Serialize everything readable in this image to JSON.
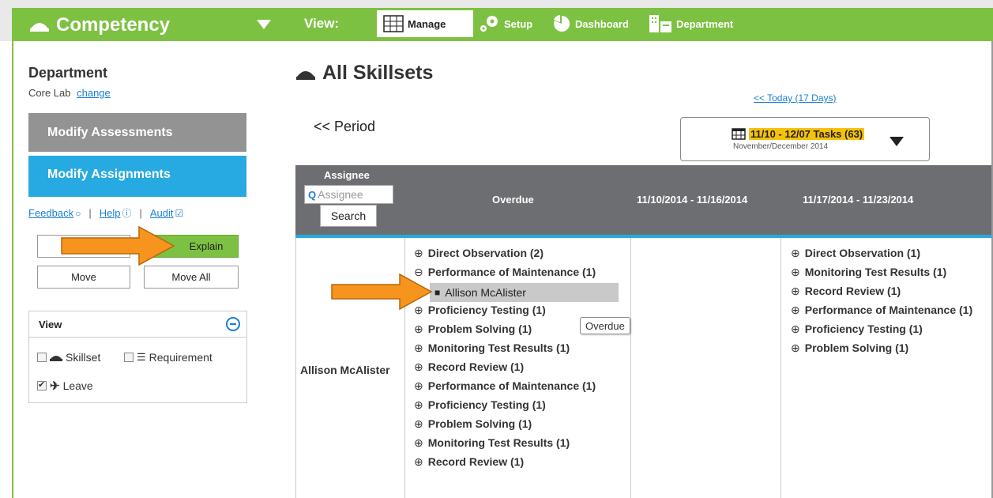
{
  "header": {
    "app_title": "Competency",
    "view_label": "View:",
    "nav": [
      {
        "label": "Manage",
        "icon": "grid-icon",
        "active": true
      },
      {
        "label": "Setup",
        "icon": "gears-icon"
      },
      {
        "label": "Dashboard",
        "icon": "pie-chart-icon"
      },
      {
        "label": "Department",
        "icon": "building-icon"
      }
    ],
    "accent_color": "#7dc142"
  },
  "sidebar": {
    "department_title": "Department",
    "department_name": "Core Lab",
    "change_link": "change",
    "modify_assessments": "Modify Assessments",
    "modify_assignments": "Modify Assignments",
    "links": {
      "feedback": "Feedback",
      "help": "Help",
      "audit": "Audit",
      "separator": "|"
    },
    "buttons": {
      "blank": "",
      "explain": "Explain",
      "move": "Move",
      "move_all": "Move All"
    },
    "view_panel": {
      "title": "View",
      "options": [
        {
          "label": "Skillset",
          "checked": false
        },
        {
          "label": "Requirement",
          "checked": false
        },
        {
          "label": "Leave",
          "checked": true
        }
      ]
    }
  },
  "main": {
    "title": "All Skillsets",
    "today_link": "<< Today (17 Days)",
    "period_link": "<< Period",
    "picker": {
      "range": "11/10 - 12/07 Tasks (63)",
      "sub": "November/December 2014",
      "highlight_color": "#f4c20d"
    },
    "table": {
      "headers": {
        "assignee": "Assignee",
        "overdue": "Overdue",
        "week1": "11/10/2014 - 11/16/2014",
        "week2": "11/17/2014 - 11/23/2014"
      },
      "assignee_placeholder": "Assignee",
      "search_button": "Search",
      "row": {
        "assignee": "Allison McAlister",
        "overdue_tasks": [
          {
            "expand": "⊕",
            "label": "Direct Observation (2)"
          },
          {
            "expand": "⊖",
            "label": "Performance of Maintenance (1)"
          },
          {
            "expand": "",
            "label": ""
          },
          {
            "expand": "⊕",
            "label": "Proficiency Testing (1)"
          },
          {
            "expand": "⊕",
            "label": "Problem Solving (1)"
          },
          {
            "expand": "⊕",
            "label": "Monitoring Test Results (1)"
          },
          {
            "expand": "⊕",
            "label": "Record Review (1)"
          },
          {
            "expand": "⊕",
            "label": "Performance of Maintenance (1)"
          },
          {
            "expand": "⊕",
            "label": "Proficiency Testing (1)"
          },
          {
            "expand": "⊕",
            "label": "Problem Solving (1)"
          },
          {
            "expand": "⊕",
            "label": "Monitoring Test Results (1)"
          },
          {
            "expand": "⊕",
            "label": "Record Review (1)"
          }
        ],
        "expanded_person": "Allison McAlister",
        "tooltip": "Overdue",
        "week2_tasks": [
          {
            "expand": "⊕",
            "label": "Direct Observation (1)"
          },
          {
            "expand": "⊕",
            "label": "Monitoring Test Results (1)"
          },
          {
            "expand": "⊕",
            "label": "Record Review (1)"
          },
          {
            "expand": "⊕",
            "label": "Performance of Maintenance (1)"
          },
          {
            "expand": "⊕",
            "label": "Proficiency Testing (1)"
          },
          {
            "expand": "⊕",
            "label": "Problem Solving (1)"
          }
        ]
      }
    }
  }
}
